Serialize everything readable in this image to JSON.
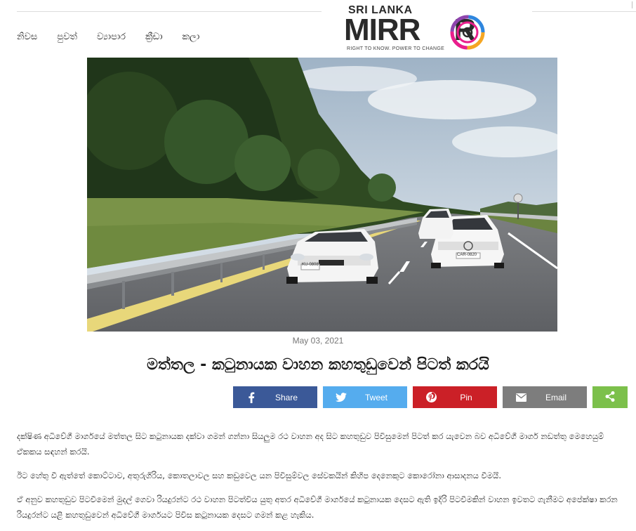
{
  "header": {
    "nav": [
      "නිවස",
      "පුවත්",
      "ව්‍යාපාර",
      "ක්‍රීඩා",
      "කලා"
    ],
    "logo": {
      "top_text": "SRI LANKA",
      "main_text": "MIRR R",
      "tagline": "RIGHT TO KNOW. POWER TO CHANGE"
    }
  },
  "article": {
    "hero_image": {
      "license_plate_left": "KU-0808",
      "license_plate_right": "CAR-0820"
    },
    "date": "May 03, 2021",
    "title": "මත්තල - කටුනායක වාහන කහතුඩුවෙන් පිටත් කරයි",
    "share": {
      "facebook": "Share",
      "twitter": "Tweet",
      "pinterest": "Pin",
      "email": "Email"
    },
    "paragraphs": [
      "දක්ෂිණ අධිවේගී මාර්ගයේ මත්තල සිට කටුනායක දක්වා ගමන් ගන්නා සියලුම රථ වාහන අද සිට කහතුඩුව පිවිසුමෙන් පිටත් කර යැවෙන බව අධිවේගී මාර්ග නඩත්තු මෙහෙයුම් ඒකකය සඳහන් කරයි.",
      "ඊට හේතු වී ඇත්තේ කොට්ටාව, අතුරුගිරිය, කොතලාවල සහ කඩුවෙල යන පිවිසුම්වල සේවකයින් කිහිප දෙනෙකුට කොරෝනා ආසාදනය වීමයි.",
      "ඒ අනුව කහතුඩුව පිටවීමෙන් මුදල් ගෙවා රියදුරන්ට රථ වාහන පිටත්විය යුතු අතර අධිවේගී මාර්ගයේ කටුනායක දෙසට ඇති ඉදිරි පිටවීමකින් වාහන ඉවතට ගැනීමට අපේක්ෂා කරන රියදුරන්ට යළි කහතුඩුවෙන් අධිවේගී මාර්ගයට පිවිස කටුනායක දෙසට ගමන් කළ හැකිය."
    ]
  },
  "colors": {
    "facebook": "#3b5998",
    "twitter": "#55acee",
    "pinterest": "#cb2027",
    "email": "#7d7d7d",
    "more": "#7cc04b"
  },
  "icons": [
    "facebook-icon",
    "twitter-icon",
    "pinterest-icon",
    "email-icon",
    "share-icon"
  ]
}
